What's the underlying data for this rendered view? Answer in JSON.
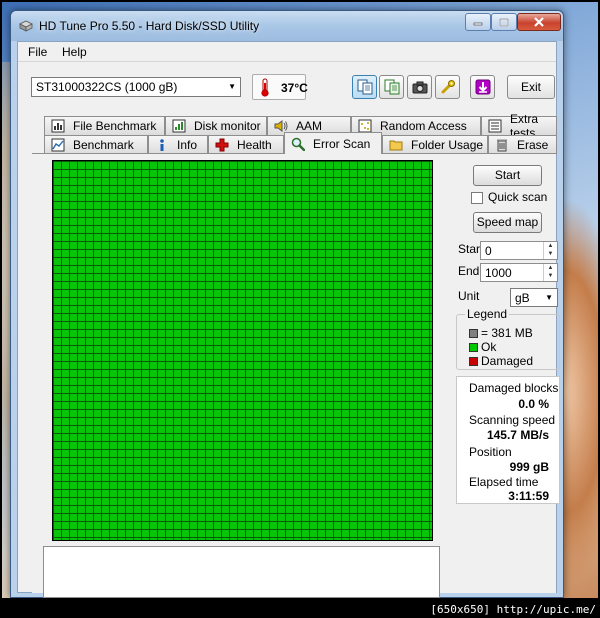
{
  "window": {
    "title": "HD Tune Pro 5.50 - Hard Disk/SSD Utility"
  },
  "menu": {
    "file": "File",
    "help": "Help"
  },
  "toolbar": {
    "drive": "ST31000322CS (1000 gB)",
    "temperature": "37°C",
    "exit_label": "Exit"
  },
  "tabs": {
    "row1": [
      "File Benchmark",
      "Disk monitor",
      "AAM",
      "Random Access",
      "Extra tests"
    ],
    "row2": [
      "Benchmark",
      "Info",
      "Health",
      "Error Scan",
      "Folder Usage",
      "Erase"
    ],
    "active": "Error Scan"
  },
  "controls": {
    "start_button": "Start",
    "quick_scan_label": "Quick scan",
    "quick_scan_checked": false,
    "speed_map_button": "Speed map",
    "start_label": "Start",
    "start_value": "0",
    "end_label": "End",
    "end_value": "1000",
    "unit_label": "Unit",
    "unit_value": "gB"
  },
  "legend": {
    "title": "Legend",
    "block": "= 381 MB",
    "ok": "Ok",
    "damaged": "Damaged",
    "colors": {
      "block": "#808080",
      "ok": "#00c800",
      "damaged": "#c80000"
    }
  },
  "stats": {
    "damaged_blocks_label": "Damaged blocks",
    "damaged_blocks_value": "0.0 %",
    "scanning_speed_label": "Scanning speed",
    "scanning_speed_value": "145.7 MB/s",
    "position_label": "Position",
    "position_value": "999 gB",
    "elapsed_label": "Elapsed time",
    "elapsed_value": "3:11:59"
  },
  "scan_grid": {
    "status": "all blocks ok",
    "color": "#09c509"
  },
  "footer": "[650x650] http://upic.me/"
}
